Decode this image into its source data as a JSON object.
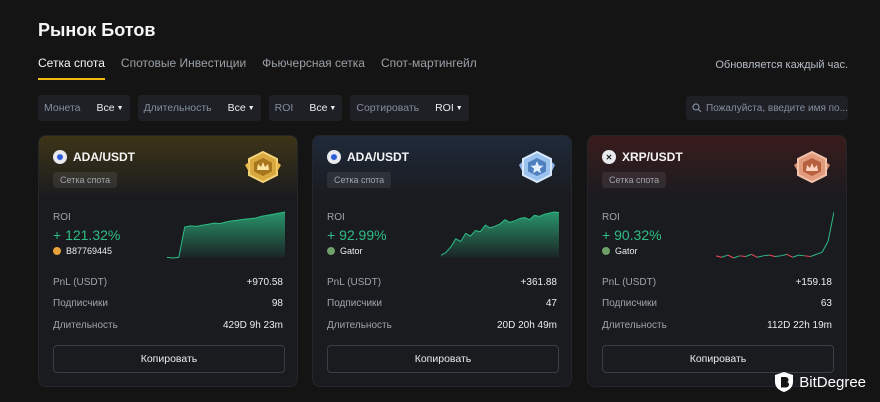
{
  "page": {
    "title": "Рынок Ботов",
    "updated": "Обновляется каждый час."
  },
  "tabs": [
    {
      "label": "Сетка спота",
      "active": true
    },
    {
      "label": "Спотовые Инвестиции",
      "active": false
    },
    {
      "label": "Фьючерсная сетка",
      "active": false
    },
    {
      "label": "Спот-мартингейл",
      "active": false
    }
  ],
  "filters": [
    {
      "label": "Монета",
      "value": "Все"
    },
    {
      "label": "Длительность",
      "value": "Все"
    },
    {
      "label": "ROI",
      "value": "Все"
    },
    {
      "label": "Сортировать",
      "value": "ROI"
    }
  ],
  "search": {
    "placeholder": "Пожалуйста, введите имя по..."
  },
  "cards": [
    {
      "pair": "ADA/USDT",
      "tag": "Сетка спота",
      "roi_label": "ROI",
      "roi": "+ 121.32%",
      "trader": "B87769445",
      "badge": "gold",
      "chart_data": {
        "type": "area",
        "x": [
          0,
          1,
          2,
          3,
          4,
          5,
          6,
          7,
          8,
          9,
          10,
          11,
          12,
          13,
          14,
          15,
          16,
          17,
          18,
          19,
          20
        ],
        "values": [
          0,
          -1,
          0,
          55,
          57,
          56,
          58,
          60,
          62,
          61,
          64,
          66,
          67,
          69,
          70,
          71,
          74,
          76,
          78,
          80,
          82
        ]
      },
      "stats": [
        {
          "label": "PnL (USDT)",
          "value": "+970.58"
        },
        {
          "label": "Подписчики",
          "value": "98"
        },
        {
          "label": "Длительность",
          "value": "429D 9h 23m"
        }
      ],
      "copy": "Копировать"
    },
    {
      "pair": "ADA/USDT",
      "tag": "Сетка спота",
      "roi_label": "ROI",
      "roi": "+ 92.99%",
      "trader": "Gator",
      "badge": "silver",
      "chart_data": {
        "type": "area",
        "x": [
          0,
          1,
          2,
          3,
          4,
          5,
          6,
          7,
          8,
          9,
          10,
          11,
          12,
          13,
          14,
          15,
          16,
          17,
          18,
          19,
          20,
          21,
          22,
          23,
          24
        ],
        "values": [
          5,
          10,
          20,
          35,
          30,
          45,
          40,
          50,
          48,
          60,
          55,
          58,
          62,
          70,
          65,
          68,
          72,
          74,
          70,
          78,
          76,
          80,
          82,
          84,
          83
        ]
      },
      "stats": [
        {
          "label": "PnL (USDT)",
          "value": "+361.88"
        },
        {
          "label": "Подписчики",
          "value": "47"
        },
        {
          "label": "Длительность",
          "value": "20D 20h 49m"
        }
      ],
      "copy": "Копировать"
    },
    {
      "pair": "XRP/USDT",
      "tag": "Сетка спота",
      "roi_label": "ROI",
      "roi": "+ 90.32%",
      "trader": "Gator",
      "badge": "bronze",
      "chart_data": {
        "type": "line",
        "x": [
          0,
          1,
          2,
          3,
          4,
          5,
          6,
          7,
          8,
          9,
          10,
          11,
          12,
          13,
          14,
          15,
          16,
          17,
          18,
          19,
          20
        ],
        "values": [
          0,
          -2,
          1,
          -3,
          0,
          -1,
          2,
          -2,
          0,
          1,
          -1,
          0,
          2,
          -2,
          1,
          0,
          -1,
          2,
          5,
          20,
          60
        ]
      },
      "stats": [
        {
          "label": "PnL (USDT)",
          "value": "+159.18"
        },
        {
          "label": "Подписчики",
          "value": "63"
        },
        {
          "label": "Длительность",
          "value": "112D 22h 19m"
        }
      ],
      "copy": "Копировать"
    }
  ],
  "brand": {
    "name": "BitDegree"
  },
  "colors": {
    "accent": "#f0b90b",
    "positive": "#2ebd85",
    "negative": "#f6465d"
  }
}
